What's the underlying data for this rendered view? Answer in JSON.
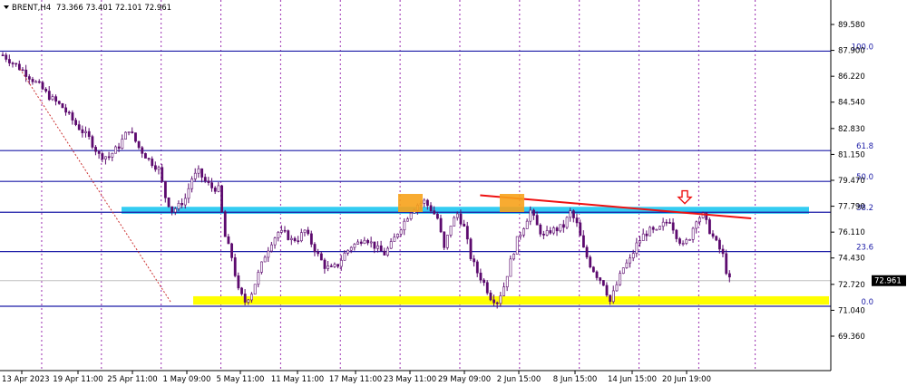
{
  "header": {
    "symbol": "BRENT,H4",
    "ohlc": "73.366 73.401 72.101 72.961"
  },
  "chart_data": {
    "type": "candlestick",
    "symbol": "BRENT",
    "timeframe": "H4",
    "ohlc_last": {
      "open": 73.366,
      "high": 73.401,
      "low": 72.101,
      "close": 72.961
    },
    "current_price": "72.961",
    "y_ticks": [
      "89.580",
      "87.900",
      "86.220",
      "84.540",
      "82.830",
      "81.150",
      "79.470",
      "77.790",
      "76.110",
      "74.430",
      "72.720",
      "71.040",
      "69.360"
    ],
    "x_ticks": [
      "13 Apr 2023",
      "19 Apr 11:00",
      "25 Apr 11:00",
      "1 May 09:00",
      "5 May 11:00",
      "11 May 11:00",
      "17 May 11:00",
      "23 May 11:00",
      "29 May 09:00",
      "2 Jun 15:00",
      "8 Jun 15:00",
      "14 Jun 15:00",
      "20 Jun 19:00"
    ],
    "fibonacci_levels": [
      {
        "label": "100.0",
        "price": 87.85
      },
      {
        "label": "61.8",
        "price": 81.4
      },
      {
        "label": "50.0",
        "price": 79.4
      },
      {
        "label": "38.2",
        "price": 77.4
      },
      {
        "label": "23.6",
        "price": 74.85
      },
      {
        "label": "0.0",
        "price": 71.3
      }
    ],
    "close_path": [
      [
        0,
        87.6
      ],
      [
        6,
        86.6
      ],
      [
        11,
        85.6
      ],
      [
        14,
        84.9
      ],
      [
        18,
        84.2
      ],
      [
        22,
        83.1
      ],
      [
        26,
        82.2
      ],
      [
        29,
        81.1
      ],
      [
        32,
        81.0
      ],
      [
        35,
        81.7
      ],
      [
        38,
        82.8
      ],
      [
        41,
        81.6
      ],
      [
        44,
        80.8
      ],
      [
        47,
        80.2
      ],
      [
        49,
        78.4
      ],
      [
        51,
        77.5
      ],
      [
        53,
        77.8
      ],
      [
        55,
        78.3
      ],
      [
        57,
        79.6
      ],
      [
        59,
        80.0
      ],
      [
        61,
        79.4
      ],
      [
        63,
        79.0
      ],
      [
        65,
        78.9
      ],
      [
        67,
        75.8
      ],
      [
        69,
        74.5
      ],
      [
        71,
        72.3
      ],
      [
        73,
        71.6
      ],
      [
        75,
        72.2
      ],
      [
        77,
        73.4
      ],
      [
        79,
        74.6
      ],
      [
        81,
        75.5
      ],
      [
        83,
        76.1
      ],
      [
        85,
        76.0
      ],
      [
        87,
        75.6
      ],
      [
        89,
        75.7
      ],
      [
        91,
        76.2
      ],
      [
        93,
        75.4
      ],
      [
        95,
        74.6
      ],
      [
        97,
        73.9
      ],
      [
        99,
        73.7
      ],
      [
        101,
        74.0
      ],
      [
        103,
        74.7
      ],
      [
        105,
        75.2
      ],
      [
        107,
        75.4
      ],
      [
        109,
        75.8
      ],
      [
        111,
        75.4
      ],
      [
        113,
        75.0
      ],
      [
        115,
        74.7
      ],
      [
        117,
        75.3
      ],
      [
        119,
        76.1
      ],
      [
        121,
        76.8
      ],
      [
        123,
        77.5
      ],
      [
        125,
        77.9
      ],
      [
        127,
        78.1
      ],
      [
        129,
        77.6
      ],
      [
        131,
        77.0
      ],
      [
        133,
        75.0
      ],
      [
        135,
        76.6
      ],
      [
        137,
        77.3
      ],
      [
        139,
        76.4
      ],
      [
        141,
        74.5
      ],
      [
        143,
        73.5
      ],
      [
        145,
        72.8
      ],
      [
        147,
        71.9
      ],
      [
        149,
        71.6
      ],
      [
        151,
        72.6
      ],
      [
        153,
        74.2
      ],
      [
        155,
        75.6
      ],
      [
        157,
        76.5
      ],
      [
        159,
        77.5
      ],
      [
        161,
        76.5
      ],
      [
        163,
        75.8
      ],
      [
        165,
        76.2
      ],
      [
        167,
        76.3
      ],
      [
        169,
        76.5
      ],
      [
        171,
        77.4
      ],
      [
        173,
        76.6
      ],
      [
        175,
        75.0
      ],
      [
        177,
        74.0
      ],
      [
        179,
        73.3
      ],
      [
        181,
        72.8
      ],
      [
        183,
        71.6
      ],
      [
        185,
        72.7
      ],
      [
        187,
        73.8
      ],
      [
        189,
        74.3
      ],
      [
        191,
        75.3
      ],
      [
        193,
        75.9
      ],
      [
        195,
        76.2
      ],
      [
        197,
        76.1
      ],
      [
        199,
        76.6
      ],
      [
        201,
        76.9
      ],
      [
        203,
        75.9
      ],
      [
        205,
        75.2
      ],
      [
        207,
        75.8
      ],
      [
        209,
        77.0
      ],
      [
        211,
        77.2
      ],
      [
        213,
        76.2
      ],
      [
        215,
        75.4
      ],
      [
        217,
        74.6
      ],
      [
        218,
        73.6
      ],
      [
        219,
        73.0
      ]
    ],
    "annotations": [
      {
        "type": "resistance-zone",
        "color": "#33ccf2",
        "price_from": 77.3,
        "price_to": 77.75
      },
      {
        "type": "support-zone",
        "color": "#ffff00",
        "price_from": 71.4,
        "price_to": 71.95
      },
      {
        "type": "trendline",
        "color": "#ee1111",
        "from": [
          125,
          78.5
        ],
        "to": [
          225,
          77.0
        ]
      },
      {
        "type": "highlight-box",
        "color": "#f7a21b",
        "center": [
          126,
          78.0
        ]
      },
      {
        "type": "highlight-box",
        "color": "#f7a21b",
        "center": [
          157,
          78.0
        ]
      },
      {
        "type": "arrow-down",
        "color": "#ee1111",
        "center": [
          209,
          78.2
        ]
      },
      {
        "type": "dotted-trendline",
        "color": "#cc3333",
        "from": [
          8,
          86.7
        ],
        "to": [
          52,
          71.5
        ]
      }
    ],
    "grid": "vertical-dotted",
    "xlim": [
      0,
      224
    ],
    "ylim": [
      68.8,
      90.6
    ]
  }
}
